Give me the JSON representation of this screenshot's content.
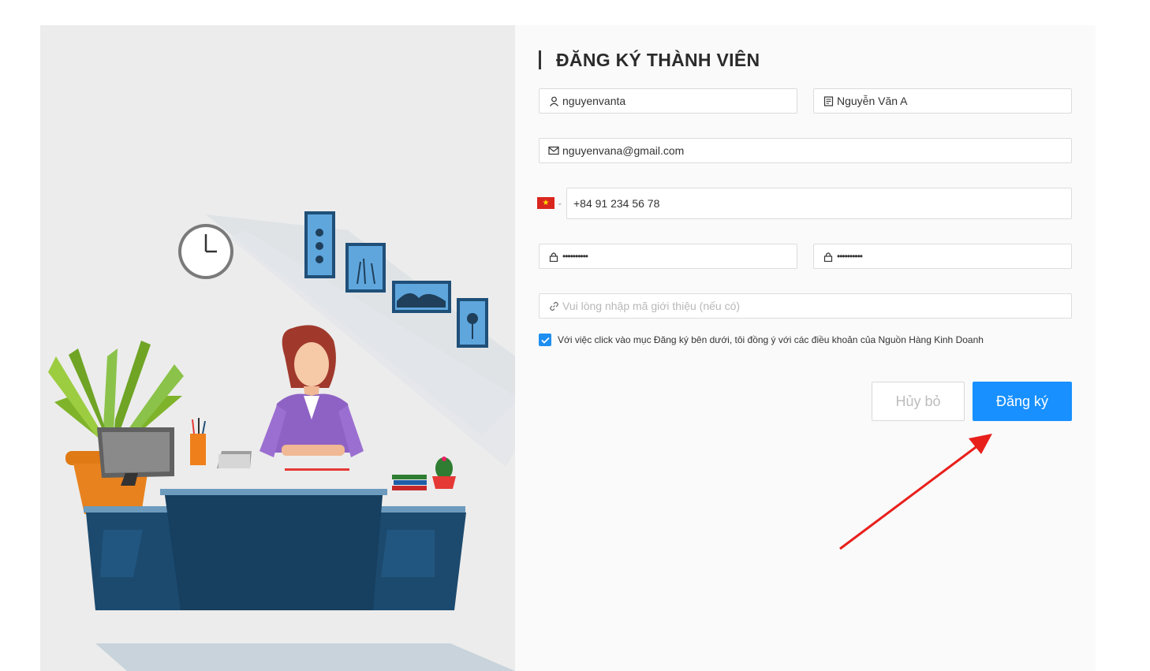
{
  "form": {
    "title": "ĐĂNG KÝ THÀNH VIÊN",
    "username": {
      "value": "nguyenvanta",
      "icon": "user-icon"
    },
    "fullname": {
      "value": "Nguyễn Văn A",
      "icon": "id-card-icon"
    },
    "email": {
      "value": "nguyenvana@gmail.com",
      "icon": "mail-icon"
    },
    "phone": {
      "country_flag": "vn-flag-icon",
      "flag_star": "★",
      "caret": "⌄",
      "value": "+84 91 234 56 78"
    },
    "password": {
      "value": "••••••••••",
      "icon": "lock-icon"
    },
    "confirm_password": {
      "value": "••••••••••",
      "icon": "lock-icon"
    },
    "referral": {
      "placeholder": "Vui lòng nhập mã giới thiệu (nếu có)",
      "value": "",
      "icon": "link-icon"
    },
    "agreement": {
      "checked": true,
      "text": "Với việc click vào mục Đăng ký bên dưới, tôi đồng ý với các điều khoản của Nguồn Hàng Kinh Doanh"
    },
    "cancel_label": "Hủy bỏ",
    "submit_label": "Đăng ký"
  },
  "colors": {
    "primary": "#1890ff",
    "annotation_arrow": "#e8201c",
    "illustration_bg": "#ececec"
  }
}
